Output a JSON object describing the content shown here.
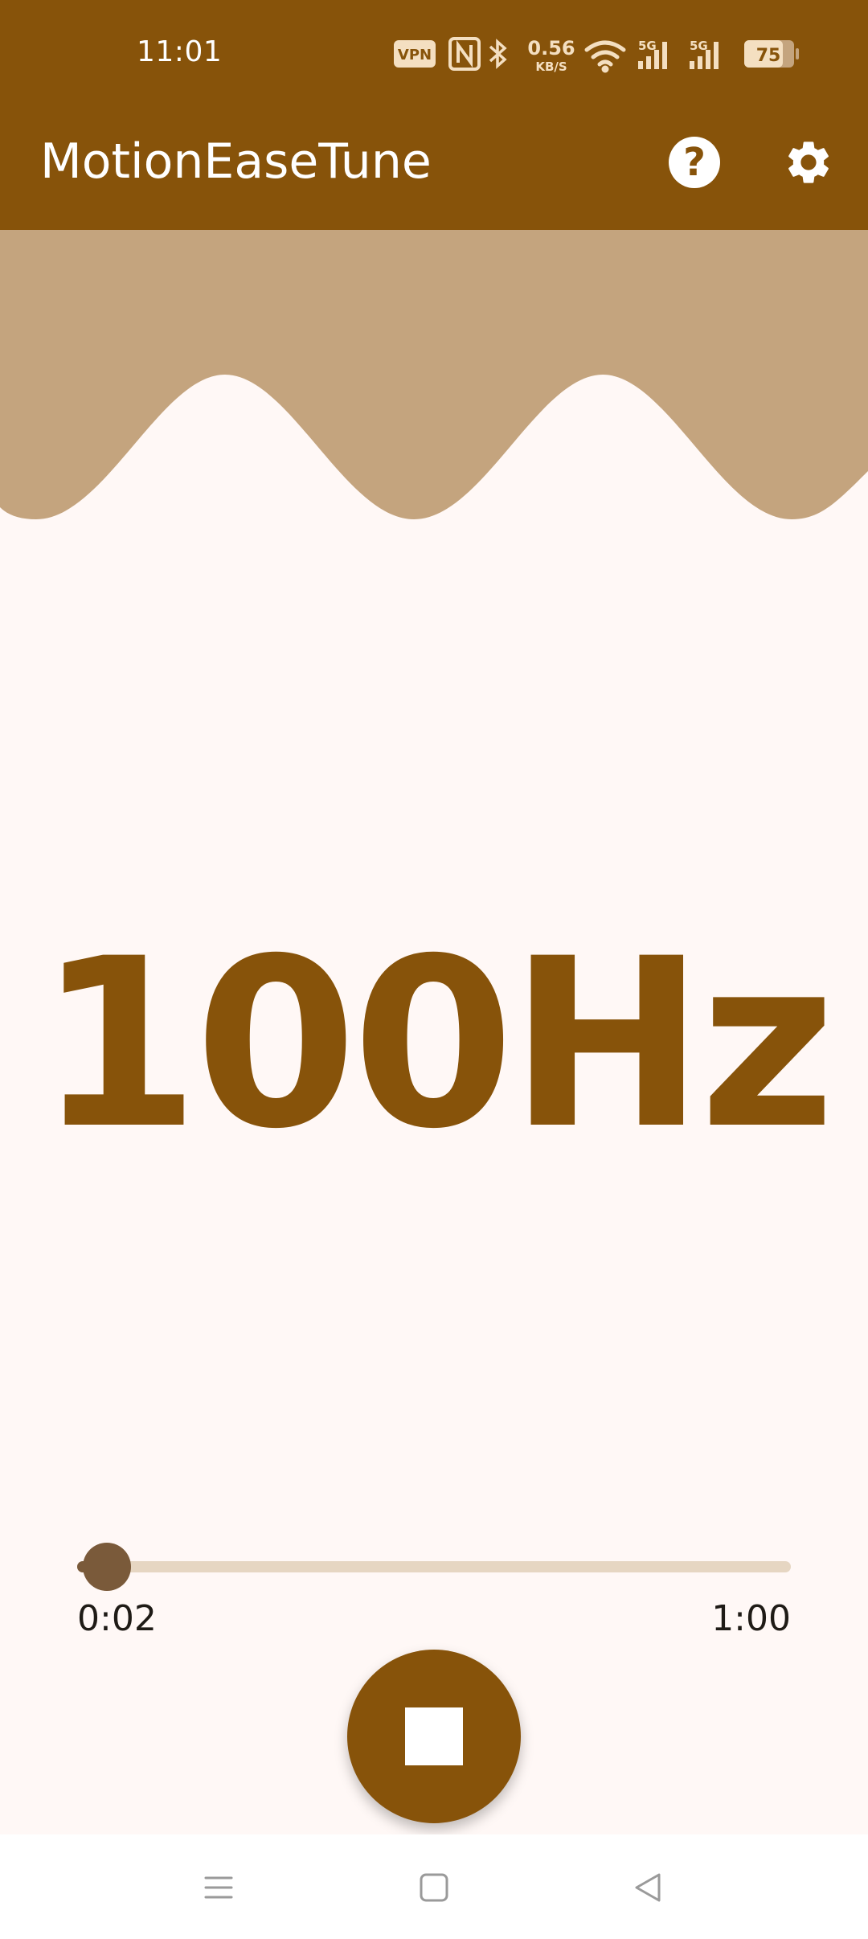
{
  "status_bar": {
    "time": "11:01",
    "vpn_label": "VPN",
    "network_speed_value": "0.56",
    "network_speed_unit": "KB/S",
    "signal_1_label": "5G",
    "signal_2_label": "5G",
    "battery_level": "75",
    "icons": [
      "nfc-icon",
      "bluetooth-icon",
      "wifi-icon",
      "cell-signal-icon",
      "battery-icon"
    ]
  },
  "app_bar": {
    "title": "MotionEaseTune",
    "help_label": "?",
    "icons": [
      "help-icon",
      "settings-gear-icon"
    ]
  },
  "main": {
    "frequency": "100Hz"
  },
  "player": {
    "elapsed": "0:02",
    "total": "1:00",
    "progress_fraction": 0.033,
    "icons": [
      "stop-icon"
    ]
  },
  "nav_bar": {
    "icons": [
      "menu-icon",
      "home-icon",
      "back-icon"
    ]
  },
  "colors": {
    "primary": "#87530a",
    "wave": "#c4a47e",
    "background": "#fff8f6",
    "slider_track": "#e6d6c2",
    "slider_thumb": "#7a5a3a"
  }
}
